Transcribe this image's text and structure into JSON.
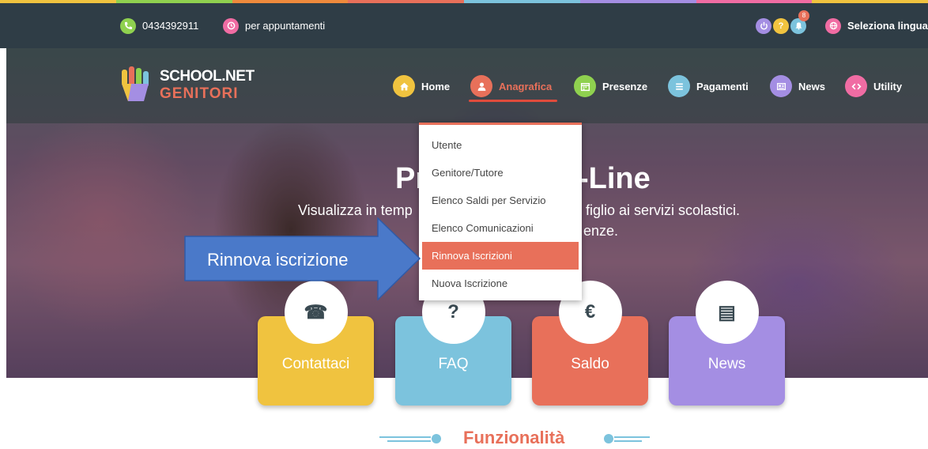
{
  "colors": {
    "strip": [
      "#f0c33f",
      "#8fd14f",
      "#ef8a3c",
      "#e8705a",
      "#7cc3dd",
      "#a48ee3",
      "#f06ca3",
      "#f0c33f"
    ],
    "topbar_bg": "#2f3d46",
    "accent": "#e8705a",
    "home": "#f0c33f",
    "anagrafica": "#e8705a",
    "presenze": "#8fd14f",
    "pagamenti": "#7cc3dd",
    "news": "#a48ee3",
    "utility": "#f06ca3",
    "arrow": "#4a79c9"
  },
  "topbar": {
    "phone_icon": "phone-icon",
    "phone": "0434392911",
    "appointments_icon": "clock-icon",
    "appointments": "per appuntamenti",
    "icons": [
      "power-icon",
      "help-icon",
      "bell-icon"
    ],
    "notifications_count": "8",
    "language_icon": "globe-icon",
    "language": "Seleziona lingua"
  },
  "logo": {
    "line1": "SCHOOL.NET",
    "line2": "GENITORI"
  },
  "nav": [
    {
      "label": "Home",
      "icon": "home-icon",
      "active": false
    },
    {
      "label": "Anagrafica",
      "icon": "user-icon",
      "active": true
    },
    {
      "label": "Presenze",
      "icon": "calendar-icon",
      "active": false
    },
    {
      "label": "Pagamenti",
      "icon": "list-icon",
      "active": false
    },
    {
      "label": "News",
      "icon": "newspaper-icon",
      "active": false
    },
    {
      "label": "Utility",
      "icon": "code-icon",
      "active": false
    }
  ],
  "dropdown": {
    "items": [
      "Utente",
      "Genitore/Tutore",
      "Elenco Saldi per Servizio",
      "Elenco Comunicazioni",
      "Rinnova Iscrizioni",
      "Nuova Iscrizione"
    ],
    "active_index": 4
  },
  "hero": {
    "title_left": "Pr",
    "title_right": "-Line",
    "subtitle_left": "Visualizza in temp",
    "subtitle_right": "figlio ai servizi scolastici.",
    "line2_right": "enze."
  },
  "annotation": {
    "label": "Rinnova iscrizione"
  },
  "cards": [
    {
      "label": "Contattaci",
      "symbol": "☎",
      "icon": "phone-icon",
      "color": "#f0c33f"
    },
    {
      "label": "FAQ",
      "symbol": "?",
      "icon": "question-icon",
      "color": "#7cc3dd"
    },
    {
      "label": "Saldo",
      "symbol": "€",
      "icon": "euro-icon",
      "color": "#e8705a"
    },
    {
      "label": "News",
      "symbol": "▤",
      "icon": "newspaper-icon",
      "color": "#a48ee3"
    }
  ],
  "section": {
    "title": "Funzionalità"
  }
}
